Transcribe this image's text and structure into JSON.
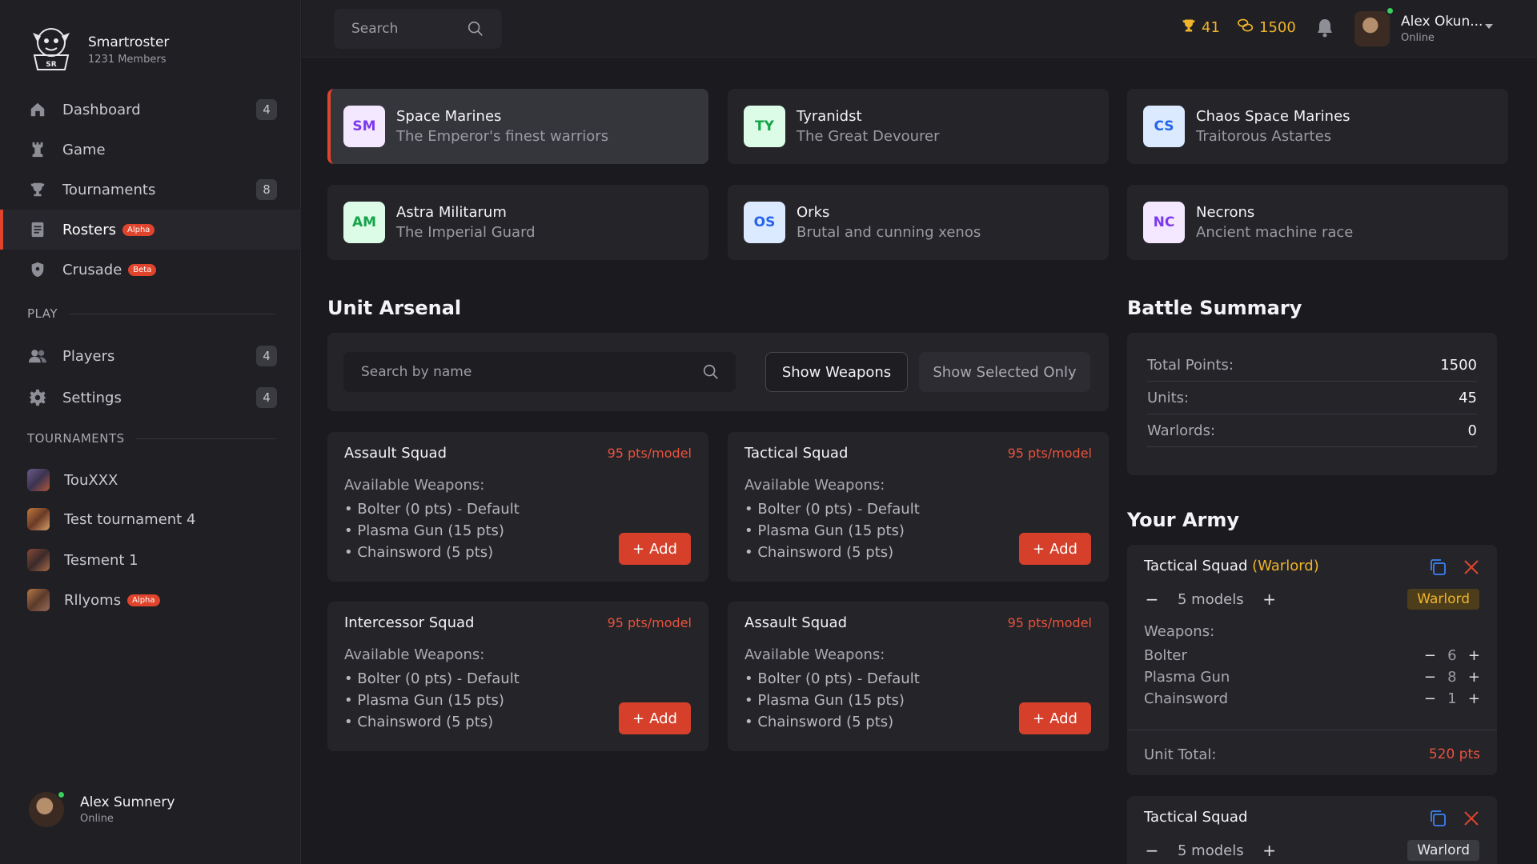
{
  "brand": {
    "name": "Smartroster",
    "members": "1231 Members"
  },
  "nav": [
    {
      "label": "Dashboard",
      "count": "4",
      "icon": "home-icon"
    },
    {
      "label": "Game",
      "count": "",
      "icon": "chess-rook-icon"
    },
    {
      "label": "Tournaments",
      "count": "8",
      "icon": "trophy-icon"
    },
    {
      "label": "Rosters",
      "tag": "Alpha",
      "icon": "list-icon",
      "active": true
    },
    {
      "label": "Crusade",
      "tag": "Beta",
      "icon": "shield-icon"
    }
  ],
  "play_section": {
    "title": "PLAY",
    "items": [
      {
        "label": "Players",
        "count": "4"
      },
      {
        "label": "Settings",
        "count": "4"
      }
    ]
  },
  "tournaments_section": {
    "title": "TOURNAMENTS",
    "items": [
      {
        "label": "TouXXX"
      },
      {
        "label": "Test tournament 4"
      },
      {
        "label": "Tesment 1"
      },
      {
        "label": "Rllyoms",
        "tag": "Alpha"
      }
    ]
  },
  "sidebar_user": {
    "name": "Alex Sumnery",
    "status": "Online"
  },
  "topbar": {
    "search_placeholder": "Search",
    "trophies": "41",
    "coins": "1500",
    "user_name": "Alex Okun...",
    "user_status": "Online"
  },
  "factions": [
    {
      "abbr": "SM",
      "name": "Space Marines",
      "desc": "The Emperor's finest warriors",
      "badge_bg": "#f3e8ff",
      "badge_fg": "#7c3aed"
    },
    {
      "abbr": "TY",
      "name": "Tyranidst",
      "desc": "The Great Devourer",
      "badge_bg": "#dcfce7",
      "badge_fg": "#16a34a"
    },
    {
      "abbr": "CS",
      "name": "Chaos Space Marines",
      "desc": "Traitorous Astartes",
      "badge_bg": "#dbeafe",
      "badge_fg": "#2563eb"
    },
    {
      "abbr": "AM",
      "name": "Astra Militarum",
      "desc": "The Imperial Guard",
      "badge_bg": "#dcfce7",
      "badge_fg": "#16a34a"
    },
    {
      "abbr": "OS",
      "name": "Orks",
      "desc": "Brutal and cunning xenos",
      "badge_bg": "#dbeafe",
      "badge_fg": "#2563eb"
    },
    {
      "abbr": "NC",
      "name": "Necrons",
      "desc": "Ancient machine race",
      "badge_bg": "#f3e8ff",
      "badge_fg": "#7c3aed"
    }
  ],
  "arsenal": {
    "title": "Unit Arsenal",
    "search_placeholder": "Search by name",
    "show_weapons": "Show Weapons",
    "show_selected": "Show Selected Only",
    "available_label": "Available Weapons:",
    "add_label": "Add",
    "units": [
      {
        "name": "Assault Squad",
        "pts": "95 pts/model",
        "weapons": [
          "Bolter (0 pts) - Default",
          "Plasma Gun (15 pts)",
          "Chainsword (5 pts)"
        ]
      },
      {
        "name": "Tactical Squad",
        "pts": "95 pts/model",
        "weapons": [
          "Bolter (0 pts) - Default",
          "Plasma Gun (15 pts)",
          "Chainsword (5 pts)"
        ]
      },
      {
        "name": "Intercessor Squad",
        "pts": "95 pts/model",
        "weapons": [
          "Bolter (0 pts) - Default",
          "Plasma Gun (15 pts)",
          "Chainsword (5 pts)"
        ]
      },
      {
        "name": "Assault Squad",
        "pts": "95 pts/model",
        "weapons": [
          "Bolter (0 pts) - Default",
          "Plasma Gun (15 pts)",
          "Chainsword (5 pts)"
        ]
      }
    ]
  },
  "summary": {
    "title": "Battle Summary",
    "rows": [
      {
        "label": "Total Points:",
        "value": "1500"
      },
      {
        "label": "Units:",
        "value": "45"
      },
      {
        "label": "Warlords:",
        "value": "0"
      }
    ]
  },
  "army": {
    "title": "Your Army",
    "entries": [
      {
        "name": "Tactical Squad",
        "warlord_suffix": "(Warlord)",
        "models": "5 models",
        "badge": "Warlord",
        "weapons_label": "Weapons:",
        "weapons": [
          {
            "name": "Bolter",
            "count": "6"
          },
          {
            "name": "Plasma Gun",
            "count": "8"
          },
          {
            "name": "Chainsword",
            "count": "1"
          }
        ],
        "total_label": "Unit Total:",
        "total": "520 pts"
      },
      {
        "name": "Tactical Squad",
        "models": "5 models",
        "badge": "Warlord"
      }
    ]
  },
  "colors": {
    "accent": "#e0442c",
    "gold": "#f0b429",
    "bg": "#1a1a1f",
    "card": "#242429"
  }
}
